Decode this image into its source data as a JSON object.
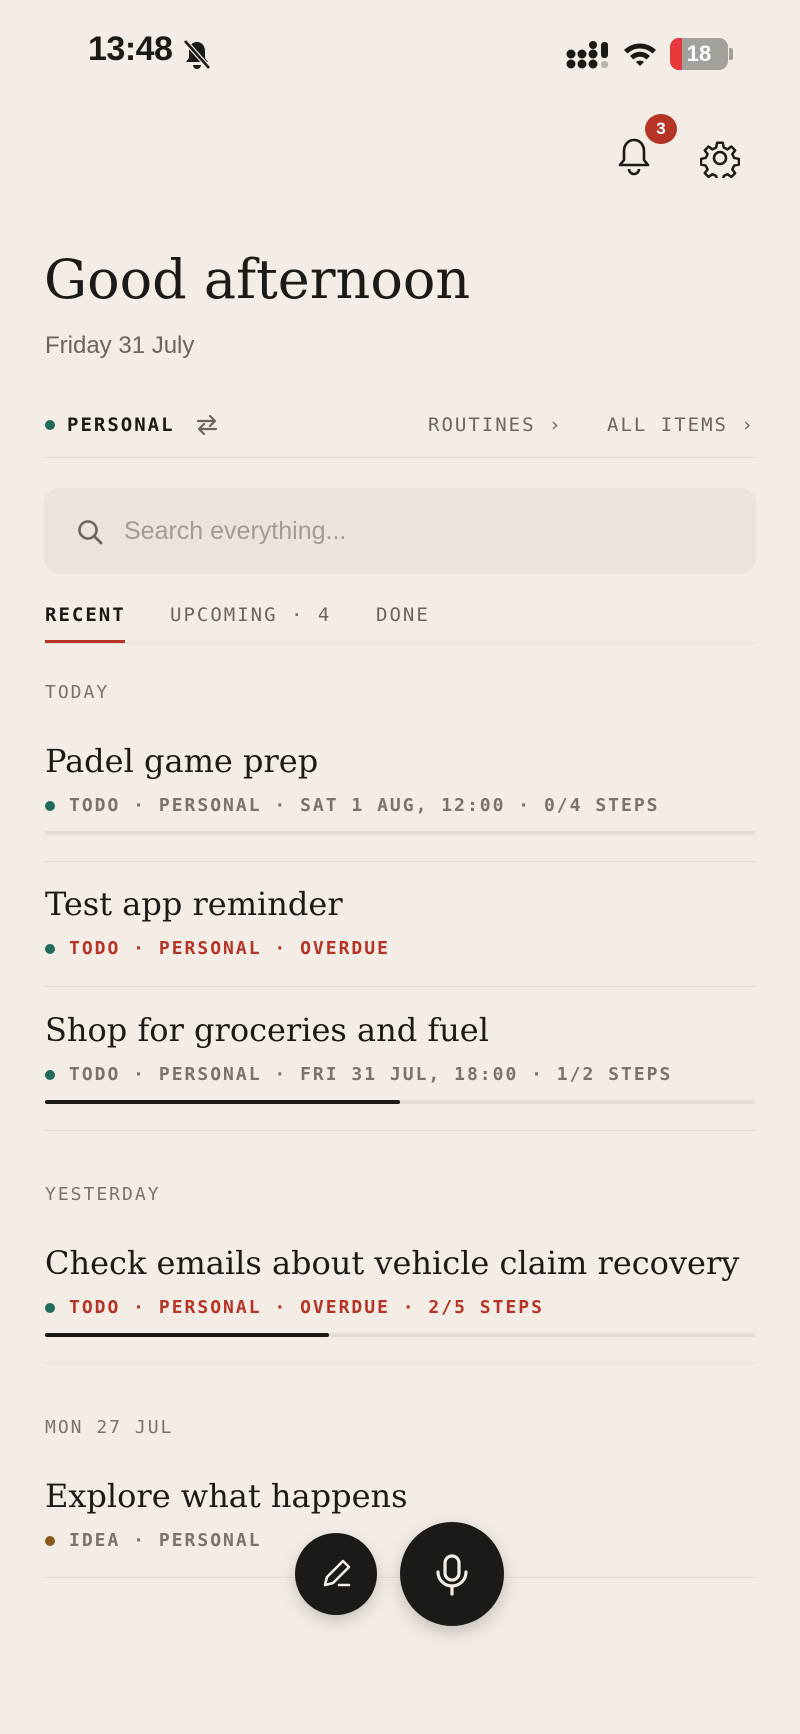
{
  "status_bar": {
    "time": "13:48",
    "battery": "18"
  },
  "header": {
    "notification_count": "3"
  },
  "greeting": "Good afternoon",
  "date": "Friday 31 July",
  "workspace": {
    "name": "PERSONAL",
    "routines": "ROUTINES ›",
    "all_items": "ALL ITEMS ›"
  },
  "search": {
    "placeholder": "Search everything..."
  },
  "tabs": [
    {
      "label": "RECENT",
      "active": true
    },
    {
      "label": "UPCOMING · 4"
    },
    {
      "label": "DONE"
    }
  ],
  "sections": [
    {
      "label": "TODAY",
      "items": [
        {
          "title": "Padel game prep",
          "meta": "TODO · PERSONAL · SAT 1 AUG, 12:00 · 0/4 STEPS",
          "progress": 0.0
        },
        {
          "title": "Test app reminder",
          "meta": "TODO · PERSONAL · OVERDUE"
        },
        {
          "title": "Shop for groceries and fuel",
          "meta": "TODO · PERSONAL · FRI 31 JUL, 18:00 · 1/2 STEPS",
          "progress": 0.5
        }
      ]
    },
    {
      "label": "YESTERDAY",
      "items": [
        {
          "title": "Check emails about vehicle claim recovery",
          "meta": "TODO · PERSONAL · OVERDUE · 2/5 STEPS",
          "progress": 0.4
        }
      ]
    },
    {
      "label": "MON 27 JUL",
      "items": [
        {
          "title": "Explore what happens",
          "meta": "IDEA · PERSONAL"
        }
      ]
    }
  ],
  "colors": {
    "background": "#f3ede5",
    "accent_red": "#b63426",
    "todo_dot": "#1f6b5c",
    "idea_dot": "#8a5a1c",
    "ink": "#1c1a17"
  },
  "icons": {
    "silent": "bell-slash-icon",
    "signal": "cellular-signal-icon",
    "wifi": "wifi-icon",
    "notifications": "bell-icon",
    "settings": "gear-icon",
    "swap": "swap-arrows-icon",
    "search": "search-icon",
    "compose": "pencil-icon",
    "voice": "microphone-icon"
  }
}
